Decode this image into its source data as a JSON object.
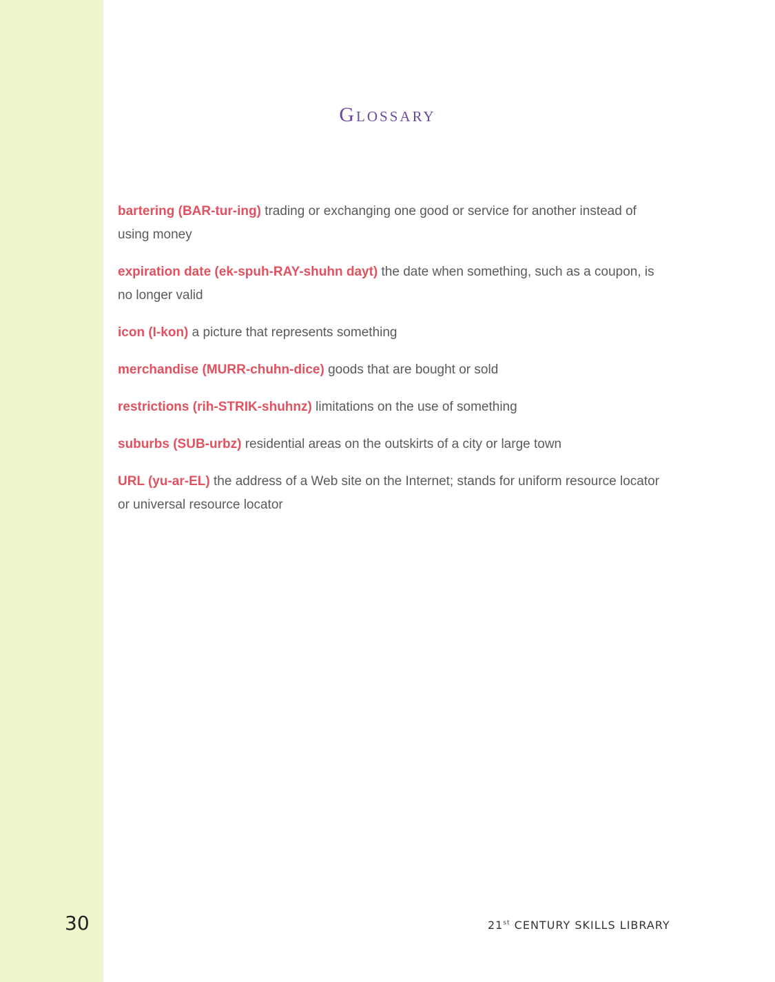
{
  "page": {
    "title": "Glossary",
    "page_number": "30",
    "footer": {
      "number": "21",
      "superscript": "st",
      "text": " CENTURY SKILLS LIBRARY"
    },
    "colors": {
      "side_band": "#eff5cc",
      "title": "#6a4a9c",
      "term": "#e0525f",
      "definition": "#5a5a5a"
    }
  },
  "glossary": [
    {
      "term": "bartering (BAR-tur-ing)",
      "definition": "trading or exchanging one good or service for another instead of using money"
    },
    {
      "term": "expiration date (ek-spuh-RAY-shuhn dayt)",
      "definition": "the date when something, such as a coupon, is no longer valid"
    },
    {
      "term": "icon (I-kon)",
      "definition": "a picture that represents something"
    },
    {
      "term": "merchandise (MURR-chuhn-dice)",
      "definition": "goods that are bought or sold"
    },
    {
      "term": "restrictions (rih-STRIK-shuhnz)",
      "definition": "limitations on the use of something"
    },
    {
      "term": "suburbs (SUB-urbz)",
      "definition": "residential areas on the outskirts of a city or large town"
    },
    {
      "term": "URL (yu-ar-EL)",
      "definition": "the address of a Web site on the Internet; stands for uniform resource locator or universal resource locator"
    }
  ]
}
